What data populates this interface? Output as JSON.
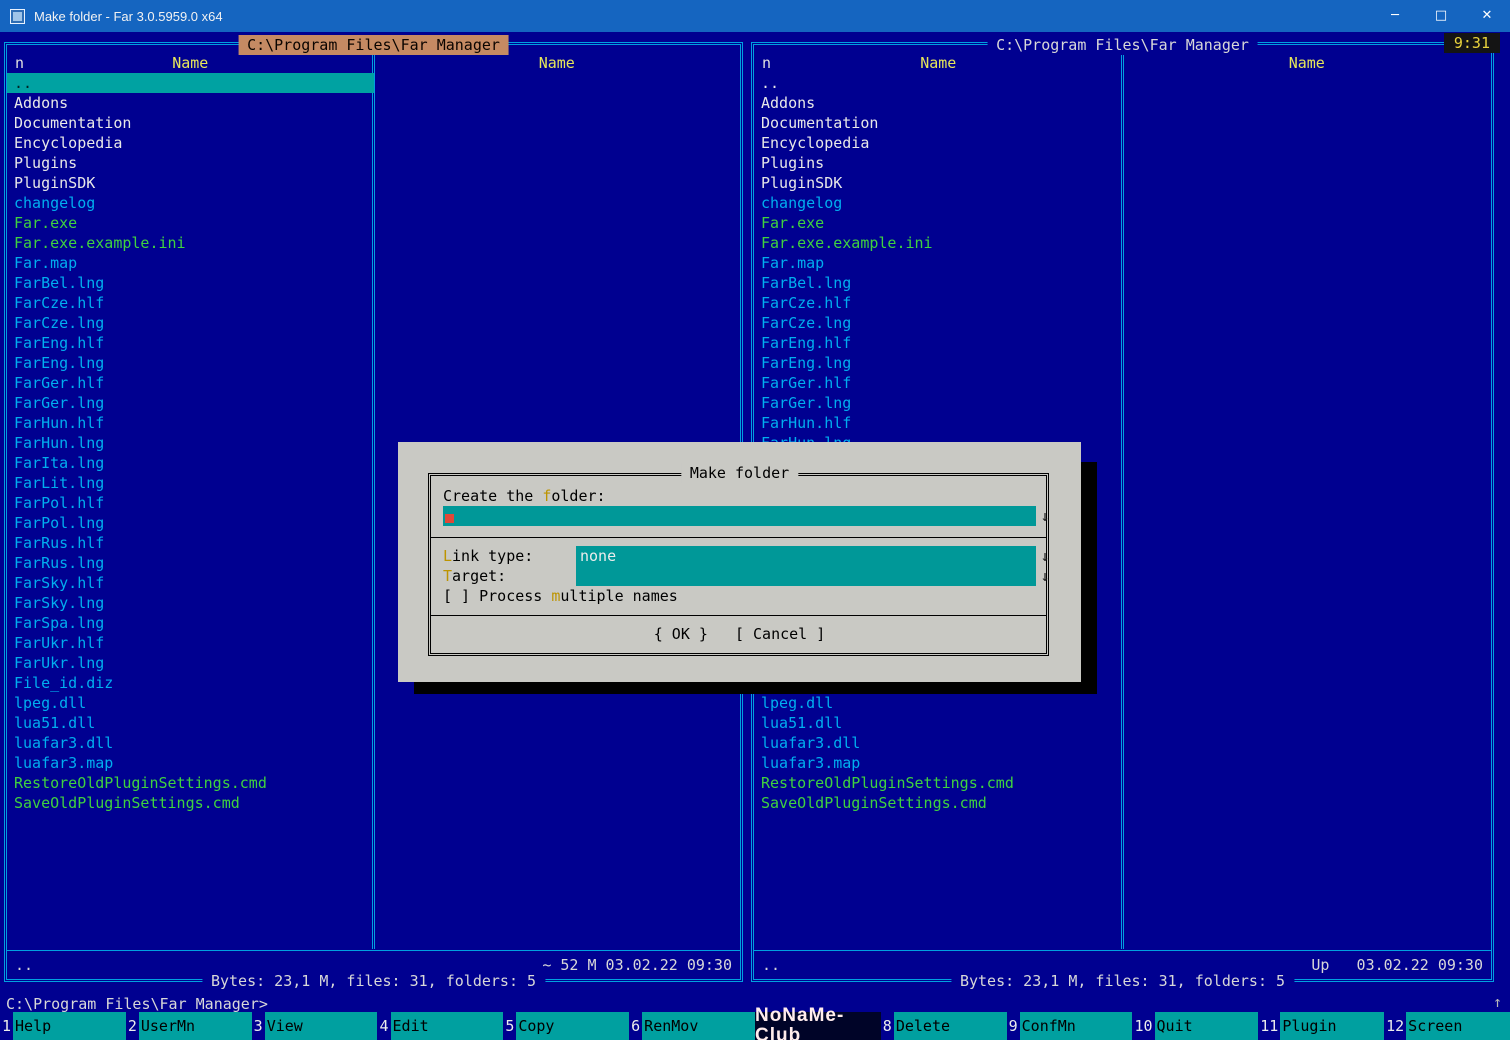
{
  "window": {
    "title": "Make folder - Far 3.0.5959.0 x64",
    "controls": {
      "minimize": "─",
      "maximize": "□",
      "close": "✕"
    }
  },
  "clock": "9:31",
  "panels": {
    "left": {
      "path": "C:\\Program Files\\Far Manager",
      "sort_indicator": "n",
      "columns": [
        "Name",
        "Name"
      ],
      "status_current": "..",
      "status_info": "~ 52 M 03.02.22 09:30",
      "totals": "Bytes: 23,1 M, files: 31, folders: 5"
    },
    "right": {
      "path": "C:\\Program Files\\Far Manager",
      "sort_indicator": "n",
      "columns": [
        "Name",
        "Name"
      ],
      "status_current": "..",
      "status_info": "Up   03.02.22 09:30",
      "totals": "Bytes: 23,1 M, files: 31, folders: 5"
    }
  },
  "files": [
    {
      "name": "..",
      "type": "updir",
      "selected": true
    },
    {
      "name": "Addons",
      "type": "folder"
    },
    {
      "name": "Documentation",
      "type": "folder"
    },
    {
      "name": "Encyclopedia",
      "type": "folder"
    },
    {
      "name": "Plugins",
      "type": "folder"
    },
    {
      "name": "PluginSDK",
      "type": "folder"
    },
    {
      "name": "changelog",
      "type": "file"
    },
    {
      "name": "Far.exe",
      "type": "exec"
    },
    {
      "name": "Far.exe.example.ini",
      "type": "exec"
    },
    {
      "name": "Far.map",
      "type": "file"
    },
    {
      "name": "FarBel.lng",
      "type": "file"
    },
    {
      "name": "FarCze.hlf",
      "type": "file"
    },
    {
      "name": "FarCze.lng",
      "type": "file"
    },
    {
      "name": "FarEng.hlf",
      "type": "file"
    },
    {
      "name": "FarEng.lng",
      "type": "file"
    },
    {
      "name": "FarGer.hlf",
      "type": "file"
    },
    {
      "name": "FarGer.lng",
      "type": "file"
    },
    {
      "name": "FarHun.hlf",
      "type": "file"
    },
    {
      "name": "FarHun.lng",
      "type": "file"
    },
    {
      "name": "FarIta.lng",
      "type": "file"
    },
    {
      "name": "FarLit.lng",
      "type": "file"
    },
    {
      "name": "FarPol.hlf",
      "type": "file"
    },
    {
      "name": "FarPol.lng",
      "type": "file"
    },
    {
      "name": "FarRus.hlf",
      "type": "file"
    },
    {
      "name": "FarRus.lng",
      "type": "file"
    },
    {
      "name": "FarSky.hlf",
      "type": "file"
    },
    {
      "name": "FarSky.lng",
      "type": "file"
    },
    {
      "name": "FarSpa.lng",
      "type": "file"
    },
    {
      "name": "FarUkr.hlf",
      "type": "file"
    },
    {
      "name": "FarUkr.lng",
      "type": "file"
    },
    {
      "name": "File_id.diz",
      "type": "file"
    },
    {
      "name": "lpeg.dll",
      "type": "file"
    },
    {
      "name": "lua51.dll",
      "type": "file"
    },
    {
      "name": "luafar3.dll",
      "type": "file"
    },
    {
      "name": "luafar3.map",
      "type": "file"
    },
    {
      "name": "RestoreOldPluginSettings.cmd",
      "type": "exec"
    },
    {
      "name": "SaveOldPluginSettings.cmd",
      "type": "exec"
    }
  ],
  "dialog": {
    "title": "Make folder",
    "create_label": {
      "pre": "Create the ",
      "key": "f",
      "post": "older:"
    },
    "folder_input_value": "",
    "arrow": "↓",
    "link_label": {
      "pre": "",
      "key": "L",
      "post": "ink type:"
    },
    "link_type_value": "none",
    "target_label": {
      "pre": "",
      "key": "T",
      "post": "arget:"
    },
    "target_value": "",
    "checkbox": {
      "box": "[ ]",
      "pre": " Process ",
      "key": "m",
      "post": "ultiple names"
    },
    "ok": "{ OK }",
    "cancel": "[ Cancel ]"
  },
  "cmdline": {
    "prompt": "C:\\Program Files\\Far Manager>",
    "history_arrow": "↑"
  },
  "keybar": {
    "keys": [
      {
        "num": "1",
        "label": "Help"
      },
      {
        "num": "2",
        "label": "UserMn"
      },
      {
        "num": "3",
        "label": "View"
      },
      {
        "num": "4",
        "label": "Edit"
      },
      {
        "num": "5",
        "label": "Copy"
      },
      {
        "num": "6",
        "label": "RenMov"
      },
      {
        "num": "",
        "label": "NoNaMe-Club",
        "covered": true
      },
      {
        "num": "8",
        "label": "Delete"
      },
      {
        "num": "9",
        "label": "ConfMn"
      },
      {
        "num": "10",
        "label": "Quit"
      },
      {
        "num": "11",
        "label": "Plugin"
      },
      {
        "num": "12",
        "label": "Screen"
      }
    ]
  },
  "colors": {
    "background": "#000090",
    "panel_border": "#00A0E0",
    "selection_bg": "#00A2A2",
    "active_path_bg": "#C58A63",
    "folder_text": "#E8E8E8",
    "file_text": "#00AEEF",
    "executable_text": "#3FD23F",
    "header_text": "#E6E65A",
    "dialog_bg": "#C9C9C4",
    "input_bg": "#009898",
    "keybar_label_bg": "#00A0A0",
    "titlebar_bg": "#1565C0",
    "clock_text": "#E8D23C"
  }
}
